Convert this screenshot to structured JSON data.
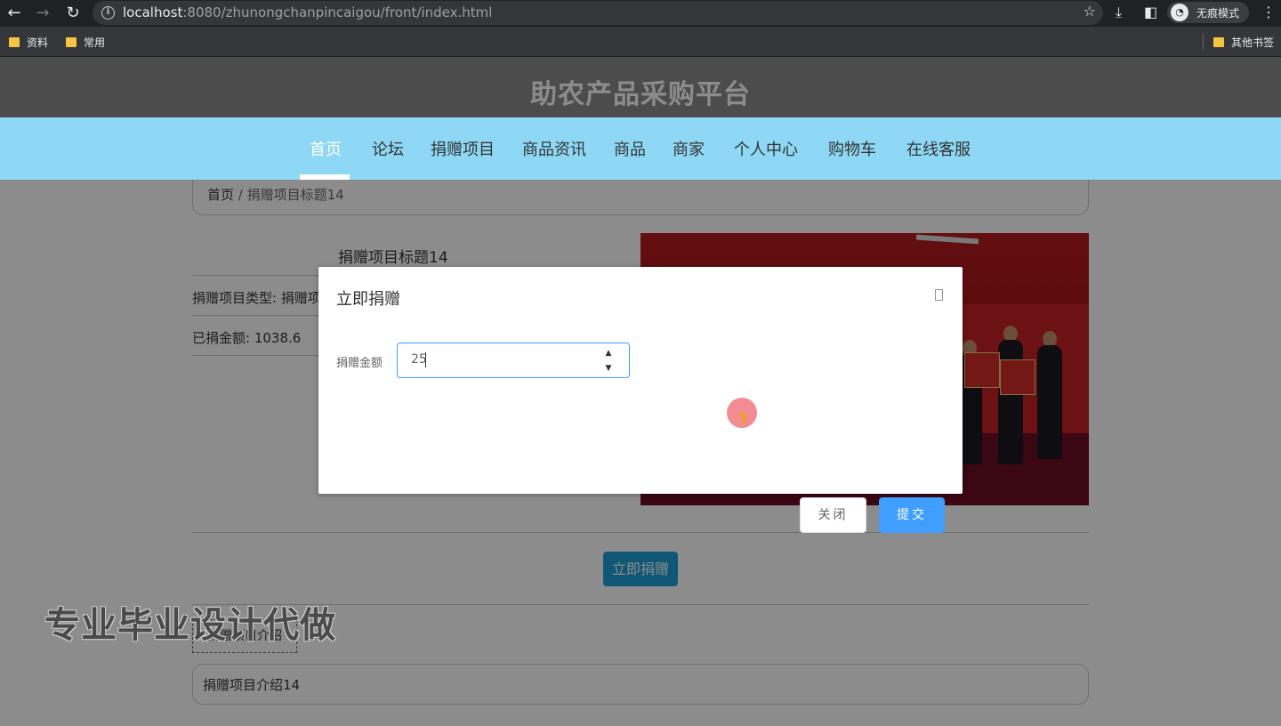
{
  "browser": {
    "url_host": "localhost",
    "url_rest": ":8080/zhunongchanpincaigou/front/index.html",
    "incognito_label": "无痕模式",
    "bookmarks": [
      "资料",
      "常用"
    ],
    "other_bookmarks": "其他书签"
  },
  "site": {
    "title": "助农产品采购平台",
    "nav": [
      "首页",
      "论坛",
      "捐赠项目",
      "商品资讯",
      "商品",
      "商家",
      "个人中心",
      "购物车",
      "在线客服"
    ],
    "active_nav": "首页"
  },
  "breadcrumb": {
    "home": "首页",
    "separator": "/",
    "current": "捐赠项目标题14"
  },
  "detail": {
    "title": "捐赠项目标题14",
    "type_row": "捐赠项目类型: 捐赠项",
    "amount_row": "已捐金额: 1038.6",
    "donate_button": "立即捐赠",
    "intro_tab": "捐赠项目介绍",
    "intro_text": "捐赠项目介绍14"
  },
  "watermark": "专业毕业设计代做",
  "modal": {
    "title": "立即捐赠",
    "field_label": "捐赠金额",
    "field_value": "25",
    "cancel_button": "关闭",
    "submit_button": "提交"
  },
  "icons": {
    "back": "arrow-left-icon",
    "forward": "arrow-right-icon",
    "reload": "reload-icon",
    "info": "info-icon",
    "bookmark_star": "star-icon",
    "download": "download-icon",
    "sidepanel": "sidepanel-icon",
    "incognito": "incognito-icon",
    "menu": "menu-dots-icon",
    "folder": "folder-icon",
    "modal_close": "close-icon"
  },
  "colors": {
    "nav_bg": "#8ed8f5",
    "primary": "#409eff",
    "donate_button": "#1e9fd8"
  }
}
